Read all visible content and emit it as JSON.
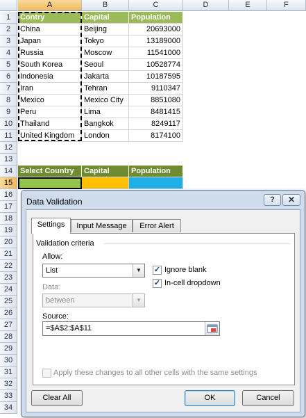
{
  "columns": [
    "A",
    "B",
    "C",
    "D",
    "E",
    "F"
  ],
  "rows": [
    "1",
    "2",
    "3",
    "4",
    "5",
    "6",
    "7",
    "8",
    "9",
    "10",
    "11",
    "12",
    "13",
    "14",
    "15",
    "16",
    "17",
    "18",
    "19",
    "20",
    "21",
    "22",
    "23",
    "24",
    "25",
    "26",
    "27",
    "28",
    "29",
    "30",
    "31",
    "32",
    "33",
    "34"
  ],
  "table": {
    "headers": [
      "Contry",
      "Capital",
      "Population"
    ],
    "data": [
      [
        "China",
        "Beijing",
        "20693000"
      ],
      [
        "Japan",
        "Tokyo",
        "13189000"
      ],
      [
        "Russia",
        "Moscow",
        "11541000"
      ],
      [
        "South Korea",
        "Seoul",
        "10528774"
      ],
      [
        "Indonesia",
        "Jakarta",
        "10187595"
      ],
      [
        "Iran",
        "Tehran",
        "9110347"
      ],
      [
        "Mexico",
        "Mexico City",
        "8851080"
      ],
      [
        "Peru",
        "Lima",
        "8481415"
      ],
      [
        "Thailand",
        "Bangkok",
        "8249117"
      ],
      [
        "United Kingdom",
        "London",
        "8174100"
      ]
    ]
  },
  "lookup": {
    "headers": [
      "Select Country",
      "Capital",
      "Population"
    ],
    "colors": {
      "select": "#92c44e",
      "capital": "#ffc000",
      "population": "#1fb0e8",
      "header": "#6f8b2f"
    }
  },
  "colors": {
    "table_header": "#9bbb59",
    "accent": "#3c7fb1"
  },
  "dialog": {
    "title": "Data Validation",
    "help_label": "?",
    "close_label": "✕",
    "tabs": [
      "Settings",
      "Input Message",
      "Error Alert"
    ],
    "section_label": "Validation criteria",
    "allow_label": "Allow:",
    "allow_value": "List",
    "ignore_blank_label": "Ignore blank",
    "ignore_blank_checked": true,
    "incell_dropdown_label": "In-cell dropdown",
    "incell_dropdown_checked": true,
    "data_label": "Data:",
    "data_value": "between",
    "source_label": "Source:",
    "source_value": "=$A$2:$A$11",
    "apply_all_label": "Apply these changes to all other cells with the same settings",
    "apply_all_checked": false,
    "clear_all_label": "Clear All",
    "ok_label": "OK",
    "cancel_label": "Cancel"
  }
}
